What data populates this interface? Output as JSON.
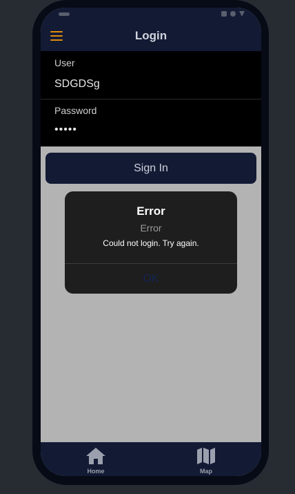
{
  "header": {
    "title": "Login",
    "menu_icon": "hamburger-menu-icon"
  },
  "form": {
    "user_label": "User",
    "user_value": "SDGDSg",
    "password_label": "Password",
    "password_value": "•••••"
  },
  "signin_label": "Sign In",
  "dialog": {
    "title": "Error",
    "subtitle": "Error",
    "message": "Could not login. Try again.",
    "ok_label": "OK"
  },
  "tabs": [
    {
      "label": "Home",
      "icon": "home-icon"
    },
    {
      "label": "Map",
      "icon": "map-icon"
    }
  ],
  "colors": {
    "accent": "#e08c0e",
    "header_bg": "#131a34",
    "dialog_bg": "#1e1e1e",
    "screen_bg": "#b3b3b3"
  }
}
